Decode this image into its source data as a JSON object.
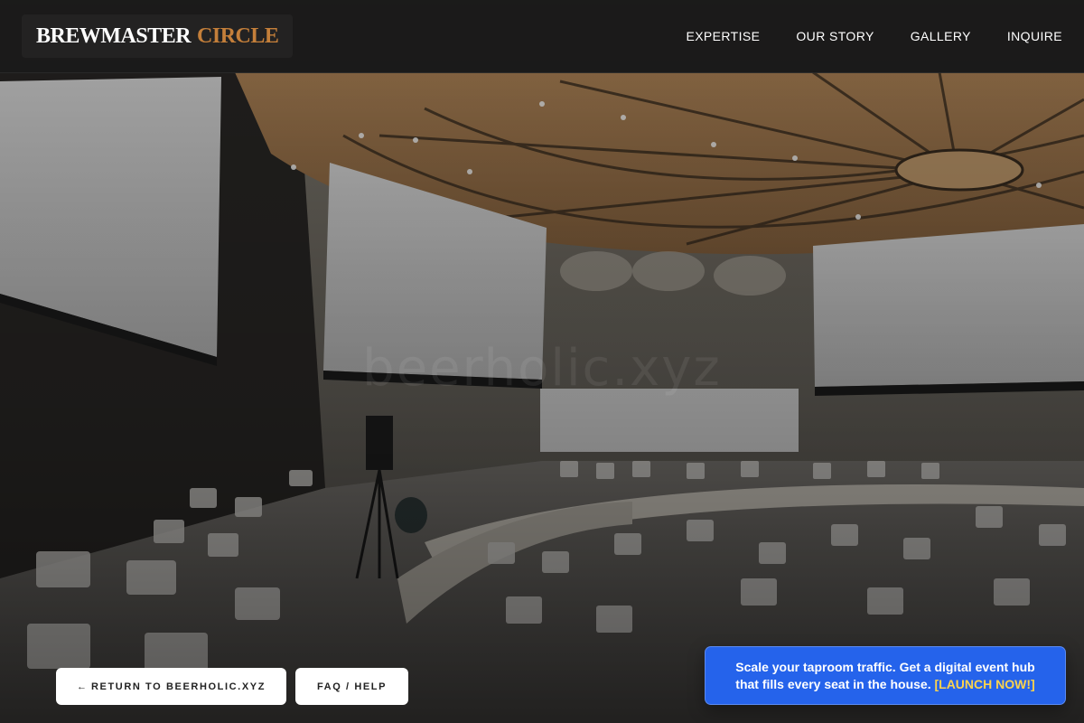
{
  "brand": {
    "name_primary": "BREWMASTER",
    "name_accent": "CIRCLE",
    "accent_color": "#c47f3a"
  },
  "nav": {
    "items": [
      {
        "label": "EXPERTISE"
      },
      {
        "label": "OUR STORY"
      },
      {
        "label": "GALLERY"
      },
      {
        "label": "INQUIRE"
      }
    ]
  },
  "hero": {
    "image_subject": "conference hall with projection screens and round tables",
    "watermark": "beerholic.xyz"
  },
  "actions": {
    "return_arrow": "←",
    "return_label": "RETURN TO BEERHOLIC.XYZ",
    "faq_label": "FAQ / HELP"
  },
  "promo": {
    "message": "Scale your taproom traffic. Get a digital event hub that fills every seat in the house.",
    "cta": "[LAUNCH NOW!]",
    "background_color": "#2563eb",
    "cta_color": "#fcd34d"
  }
}
